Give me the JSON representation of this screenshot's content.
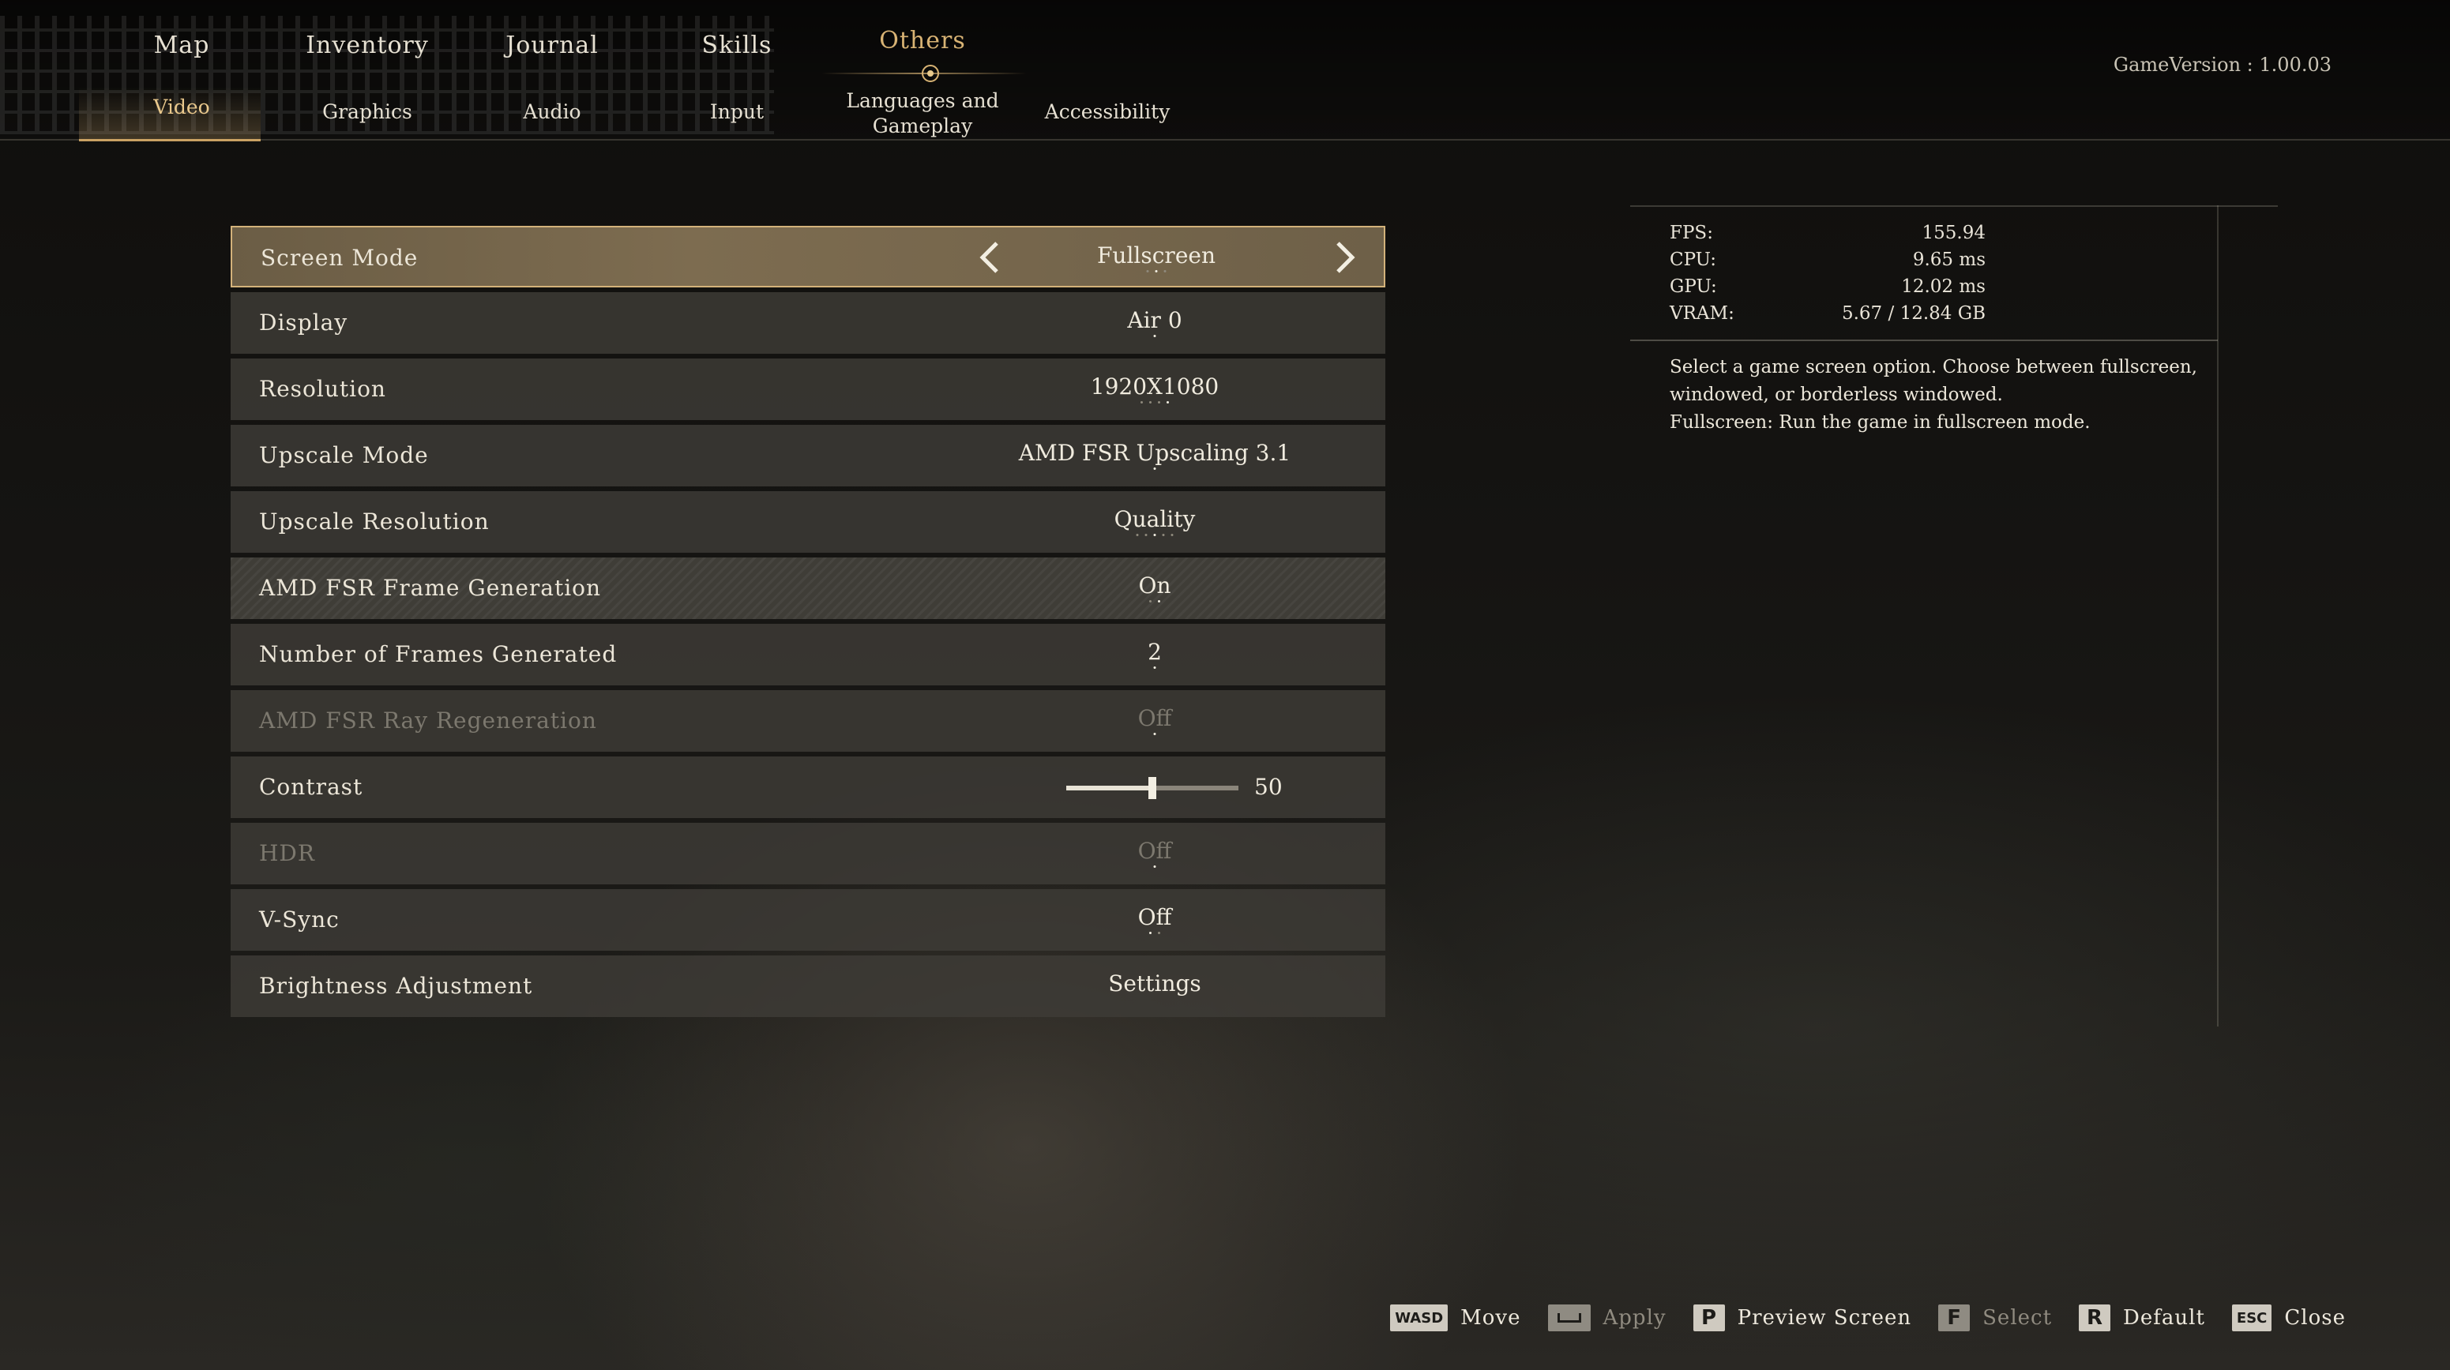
{
  "nav": {
    "main_tabs": [
      {
        "label": "Map"
      },
      {
        "label": "Inventory"
      },
      {
        "label": "Journal"
      },
      {
        "label": "Skills"
      },
      {
        "label": "Others",
        "active": true
      }
    ],
    "sub_tabs": [
      {
        "label": "Video",
        "active": true
      },
      {
        "label": "Graphics"
      },
      {
        "label": "Audio"
      },
      {
        "label": "Input"
      },
      {
        "label": "Languages and Gameplay"
      },
      {
        "label": "Accessibility"
      }
    ],
    "game_version": "GameVersion : 1.00.03"
  },
  "settings": [
    {
      "label": "Screen Mode",
      "value": "Fullscreen",
      "selected": true,
      "dots": [
        false,
        true,
        false
      ]
    },
    {
      "label": "Display",
      "value": "Air 0",
      "dots": [
        true
      ]
    },
    {
      "label": "Resolution",
      "value": "1920X1080",
      "dots": [
        false,
        false,
        false,
        true
      ]
    },
    {
      "label": "Upscale Mode",
      "value": "AMD FSR Upscaling 3.1",
      "dots": [
        true
      ]
    },
    {
      "label": "Upscale Resolution",
      "value": "Quality",
      "dots": [
        false,
        false,
        true,
        false,
        false
      ]
    },
    {
      "label": "AMD FSR Frame Generation",
      "value": "On",
      "dots": [
        false,
        true
      ]
    },
    {
      "label": "Number of Frames Generated",
      "value": "2",
      "dots": [
        true
      ]
    },
    {
      "label": "AMD FSR Ray Regeneration",
      "value": "Off",
      "disabled": true,
      "dots": [
        true
      ]
    },
    {
      "label": "Contrast",
      "slider": {
        "value": "50",
        "fraction": 0.5
      }
    },
    {
      "label": "HDR",
      "value": "Off",
      "disabled": true,
      "dots": [
        true
      ]
    },
    {
      "label": "V-Sync",
      "value": "Off",
      "dots": [
        true,
        false
      ]
    },
    {
      "label": "Brightness Adjustment",
      "value": "Settings",
      "dots": []
    }
  ],
  "stats": [
    {
      "key": "FPS:",
      "value": "155.94"
    },
    {
      "key": "CPU:",
      "value": "9.65 ms"
    },
    {
      "key": "GPU:",
      "value": "12.02 ms"
    },
    {
      "key": "VRAM:",
      "value": "5.67 / 12.84 GB"
    }
  ],
  "description": [
    "Select a game screen option. Choose between fullscreen, windowed, or borderless windowed.",
    "Fullscreen: Run the game in fullscreen mode."
  ],
  "hints": [
    {
      "key": "WASD",
      "label": "Move",
      "icon": "wasd-key-icon"
    },
    {
      "key": "",
      "label": "Apply",
      "icon": "spacebar-key-icon",
      "dim": true,
      "space": true
    },
    {
      "key": "P",
      "label": "Preview Screen",
      "icon": "p-key-icon"
    },
    {
      "key": "F",
      "label": "Select",
      "icon": "f-key-icon",
      "dim": true
    },
    {
      "key": "R",
      "label": "Default",
      "icon": "r-key-icon"
    },
    {
      "key": "ESC",
      "label": "Close",
      "icon": "esc-key-icon"
    }
  ],
  "colors": {
    "accent": "#d8b374",
    "selected_row": "#7d6c50",
    "row": "#3e3c37"
  }
}
